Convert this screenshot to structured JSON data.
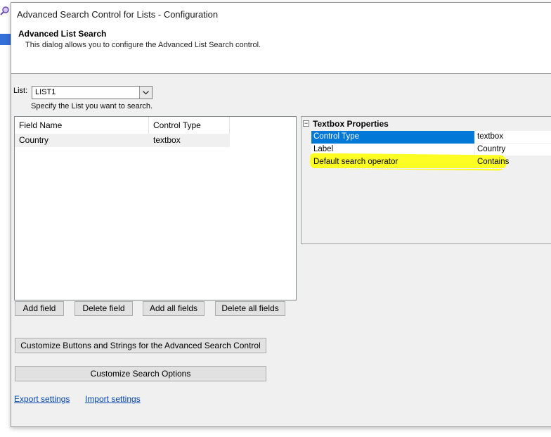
{
  "window": {
    "title": "Advanced Search Control for Lists - Configuration"
  },
  "banner": {
    "heading": "Advanced List Search",
    "description": "This dialog allows you to configure the Advanced List Search control."
  },
  "list_selector": {
    "label": "List:",
    "value": "LIST1",
    "hint": "Specify the List you want to search."
  },
  "fields_table": {
    "columns": [
      "Field Name",
      "Control Type"
    ],
    "rows": [
      {
        "field_name": "Country",
        "control_type": "textbox"
      }
    ]
  },
  "field_buttons": {
    "add": "Add field",
    "delete": "Delete field",
    "add_all": "Add all fields",
    "delete_all": "Delete all fields"
  },
  "property_grid": {
    "category": "Textbox Properties",
    "rows": [
      {
        "name": "Control Type",
        "value": "textbox"
      },
      {
        "name": "Label",
        "value": "Country"
      },
      {
        "name": "Default search operator",
        "value": "Contains"
      }
    ]
  },
  "actions": {
    "customize_buttons": "Customize Buttons and Strings for the Advanced Search Control",
    "customize_options": "Customize Search Options"
  },
  "links": {
    "export": "Export settings",
    "import": "Import settings"
  },
  "colors": {
    "selection": "#0078d7",
    "highlight": "#ffff00",
    "link": "#0645ad"
  }
}
